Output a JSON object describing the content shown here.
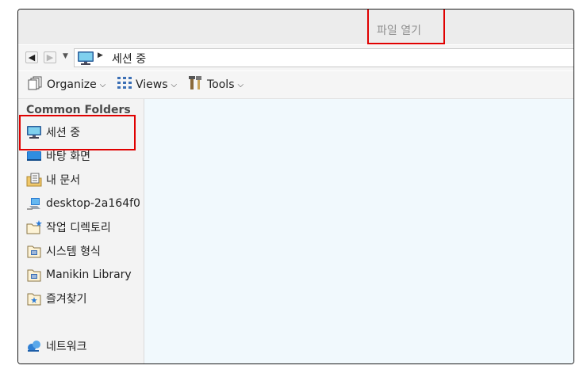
{
  "window": {
    "title": "파일 열기"
  },
  "address_bar": {
    "back_label": "◀",
    "forward_label": "▶",
    "path_separator": "▶",
    "path": "세션 중"
  },
  "toolbar": {
    "organize": "Organize",
    "views": "Views",
    "tools": "Tools"
  },
  "sidebar": {
    "heading": "Common Folders",
    "items": [
      {
        "label": "세션 중",
        "icon": "monitor-icon"
      },
      {
        "label": "바탕 화면",
        "icon": "desktop-icon"
      },
      {
        "label": "내 문서",
        "icon": "documents-icon"
      },
      {
        "label": "desktop-2a164f0",
        "icon": "computer-network-icon"
      },
      {
        "label": "작업 디렉토리",
        "icon": "folder-star-icon"
      },
      {
        "label": "시스템 형식",
        "icon": "library-folder-icon"
      },
      {
        "label": "Manikin Library",
        "icon": "library-folder-icon"
      },
      {
        "label": "즐겨찾기",
        "icon": "favorites-folder-icon"
      },
      {
        "label": "네트워크",
        "icon": "network-icon"
      }
    ]
  }
}
